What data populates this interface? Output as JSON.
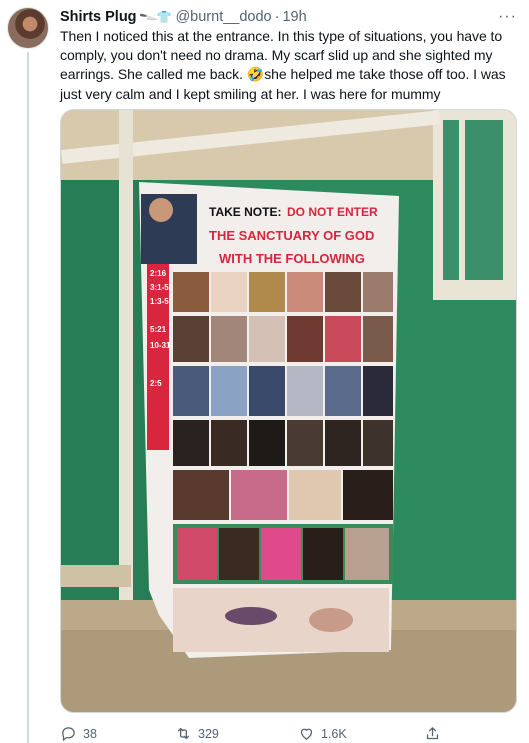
{
  "tweet": {
    "display_name": "Shirts Plug",
    "name_emojis": [
      "knife-emoji",
      "shirt-emoji"
    ],
    "handle": "@burnt__dodo",
    "separator": "·",
    "time": "19h",
    "text_before_emoji": "Then I noticed this at the entrance. In this type of situations, you have to comply, you don't need no drama. My scarf slid up and she sighted my earrings. She called me back. ",
    "emoji": "🤣",
    "text_after_emoji": "she helped me take those off too. I was just very calm and I kept smiling at her. I was here for mummy",
    "more_label": "···"
  },
  "banner": {
    "line1_black": "TAKE NOTE:",
    "line1_red": "DO NOT ENTER",
    "line2": "THE SANCTUARY OF GOD",
    "line3": "WITH THE FOLLOWING",
    "side_refs": [
      "2:16",
      "3:1-5",
      "1:3-5",
      "5:21",
      "10-31",
      "2:5"
    ]
  },
  "actions": {
    "replies": "38",
    "retweets": "329",
    "likes": "1.6K"
  },
  "colors": {
    "wall_green": "#2d8a5e",
    "banner_red": "#d7263d",
    "link_blue": "#1d9bf0",
    "muted_gray": "#536471"
  }
}
